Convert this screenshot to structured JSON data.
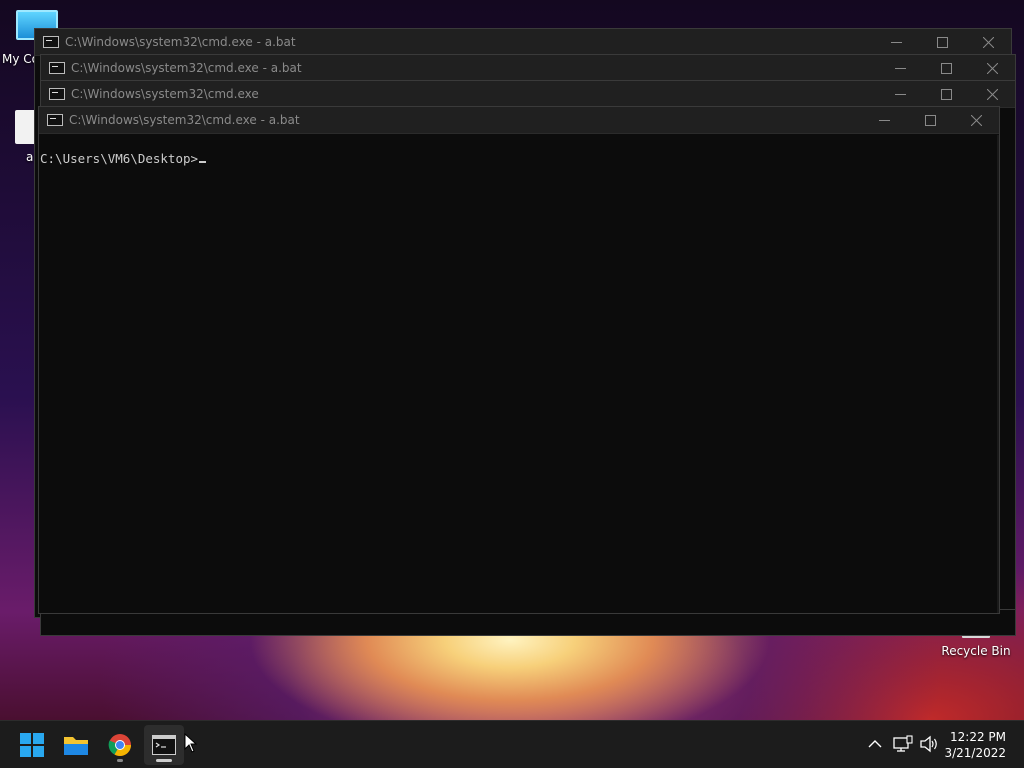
{
  "desktop": {
    "icons": [
      {
        "label": "My Co",
        "icon": "monitor-icon"
      },
      {
        "label": "a",
        "icon": "bat-file-icon"
      },
      {
        "label": "Recycle Bin",
        "icon": "recycle-bin-icon"
      }
    ]
  },
  "windows": [
    {
      "title": "C:\\Windows\\system32\\cmd.exe - a.bat"
    },
    {
      "title": "C:\\Windows\\system32\\cmd.exe - a.bat"
    },
    {
      "title": "C:\\Windows\\system32\\cmd.exe"
    },
    {
      "title": "C:\\Windows\\system32\\cmd.exe - a.bat",
      "prompt": "C:\\Users\\VM6\\Desktop>"
    }
  ],
  "taskbar": {
    "apps": [
      {
        "name": "Start",
        "icon": "windows-start-icon"
      },
      {
        "name": "File Explorer",
        "icon": "folder-icon"
      },
      {
        "name": "Google Chrome",
        "icon": "chrome-icon"
      },
      {
        "name": "Command Prompt",
        "icon": "terminal-icon"
      }
    ],
    "tray": [
      "chevron-up-icon",
      "network-icon",
      "speaker-icon"
    ],
    "time": "12:22 PM",
    "date": "3/21/2022"
  },
  "colors": {
    "console_bg": "#0c0c0c",
    "titlebar_bg": "#202020",
    "taskbar_bg": "#1c1c1c",
    "console_text": "#cccccc"
  }
}
